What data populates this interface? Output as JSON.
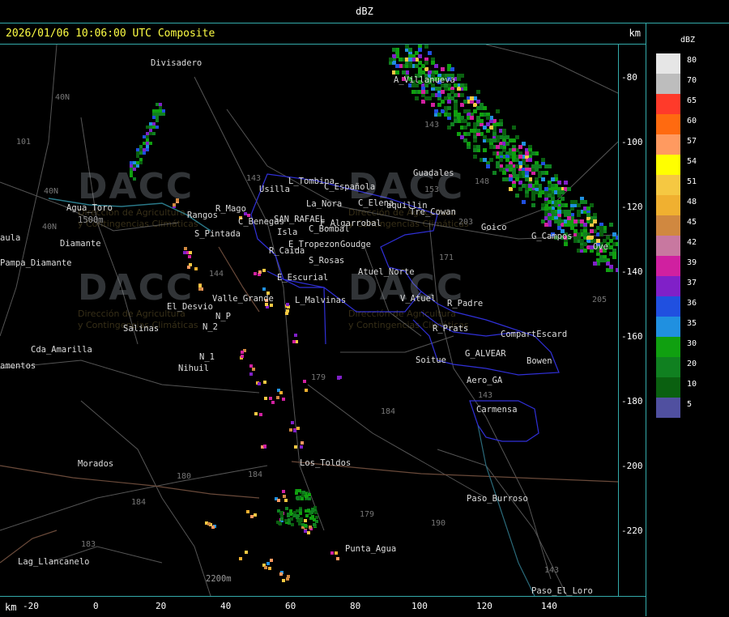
{
  "window": {
    "title": "dBZ"
  },
  "header": {
    "timestamp": "2026/01/06 10:06:00 UTC Composite",
    "unit": "km"
  },
  "x_axis": {
    "unit": "km",
    "ticks": [
      "-20",
      "0",
      "20",
      "40",
      "60",
      "80",
      "100",
      "120",
      "140"
    ]
  },
  "y_axis": {
    "ticks": [
      "-80",
      "-100",
      "-120",
      "-140",
      "-160",
      "-180",
      "-200",
      "-220"
    ]
  },
  "legend": {
    "title": "dBZ",
    "bins": [
      {
        "label": "80",
        "color": "#e6e6e6"
      },
      {
        "label": "70",
        "color": "#bdbdbd"
      },
      {
        "label": "65",
        "color": "#ff3a2a"
      },
      {
        "label": "60",
        "color": "#ff6a10"
      },
      {
        "label": "57",
        "color": "#ff9a60"
      },
      {
        "label": "54",
        "color": "#ffff00"
      },
      {
        "label": "51",
        "color": "#f5c842"
      },
      {
        "label": "48",
        "color": "#f0b030"
      },
      {
        "label": "45",
        "color": "#d08840"
      },
      {
        "label": "42",
        "color": "#c878a0"
      },
      {
        "label": "39",
        "color": "#d020a0"
      },
      {
        "label": "37",
        "color": "#8020c8"
      },
      {
        "label": "36",
        "color": "#2050e0"
      },
      {
        "label": "35",
        "color": "#2090e0"
      },
      {
        "label": "30",
        "color": "#10a010"
      },
      {
        "label": "20",
        "color": "#108020"
      },
      {
        "label": "10",
        "color": "#0a6010"
      },
      {
        "label": "5",
        "color": "#5050a0"
      }
    ]
  },
  "places": [
    "Divisadero",
    "A_Villanueva",
    "Guadales",
    "L_Tombina",
    "Usilla",
    "C_Española",
    "C_Elena",
    "aquillin",
    "Tre_Cowan",
    "La_Nora",
    "SAN_RAFAEL",
    "F_Algarrobal",
    "C_Bombal",
    "Isla",
    "C_Benegas",
    "Rangos",
    "R_Mago",
    "S_Pintada",
    "R_Caida",
    "S_Rosas",
    "E_Tropezon",
    "Goudge",
    "Goico",
    "G_Campos",
    "Ove",
    "Agua_Toro",
    "Pampa_Diamante",
    "aula",
    "Diamante",
    "E_Escurial",
    "Atuel_Norte",
    "Valle_Grande",
    "L_Malvinas",
    "El_Desvio",
    "N_P",
    "N_2",
    "Salinas",
    "V_Atuel",
    "R_Padre",
    "R_Prats",
    "CompartEscard",
    "G_ALVEAR",
    "Bowen",
    "Soitue",
    "Aero_GA",
    "Carmensa",
    "Cda_Amarilla",
    "amentos",
    "N_1",
    "Nihuil",
    "Morados",
    "Los_Toldos",
    "Paso_Burroso",
    "Punta_Agua",
    "Lag_Llancanelo",
    "Paso_El_Loro",
    "2200m",
    "1500m"
  ],
  "roads": [
    "40N",
    "40N",
    "101",
    "143",
    "153",
    "203",
    "171",
    "143",
    "144",
    "179",
    "184",
    "184",
    "180",
    "184",
    "183",
    "179",
    "190",
    "143",
    "148",
    "205",
    "143",
    "40N"
  ],
  "watermark": {
    "logo": "DACC",
    "line1": "Dirección de Agricultura",
    "line2": "y Contingencias Climáticas"
  },
  "colors": {
    "frame": "#33aaaa",
    "border": "#3030d8",
    "stamp": "#ffff44"
  }
}
